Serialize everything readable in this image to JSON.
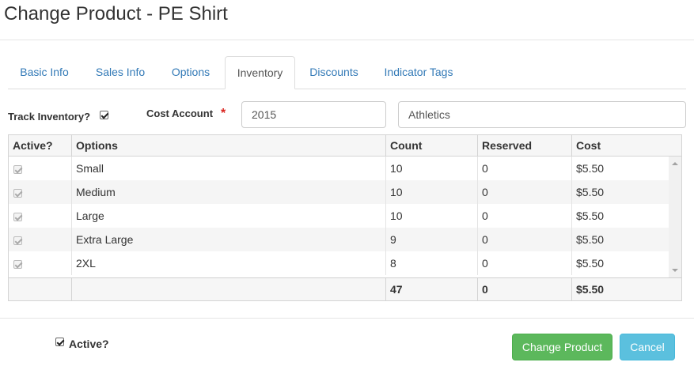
{
  "page": {
    "title": "Change Product - PE Shirt"
  },
  "tabs": [
    {
      "label": "Basic Info"
    },
    {
      "label": "Sales Info"
    },
    {
      "label": "Options"
    },
    {
      "label": "Inventory"
    },
    {
      "label": "Discounts"
    },
    {
      "label": "Indicator Tags"
    }
  ],
  "active_tab": "Inventory",
  "form": {
    "track_inventory_label": "Track Inventory?",
    "track_inventory_checked": true,
    "cost_account_label": "Cost Account",
    "required_mark": "*",
    "cost_account_code": "2015",
    "cost_account_name": "Athletics"
  },
  "grid": {
    "columns": [
      "Active?",
      "Options",
      "Count",
      "Reserved",
      "Cost"
    ],
    "rows": [
      {
        "active": true,
        "option": "Small",
        "count": "10",
        "reserved": "0",
        "cost": "$5.50"
      },
      {
        "active": true,
        "option": "Medium",
        "count": "10",
        "reserved": "0",
        "cost": "$5.50"
      },
      {
        "active": true,
        "option": "Large",
        "count": "10",
        "reserved": "0",
        "cost": "$5.50"
      },
      {
        "active": true,
        "option": "Extra Large",
        "count": "9",
        "reserved": "0",
        "cost": "$5.50"
      },
      {
        "active": true,
        "option": "2XL",
        "count": "8",
        "reserved": "0",
        "cost": "$5.50"
      }
    ],
    "totals": {
      "active": "",
      "option": "",
      "count": "47",
      "reserved": "0",
      "cost": "$5.50"
    }
  },
  "footer": {
    "active_label": "Active?",
    "active_checked": true,
    "change_button": "Change Product",
    "cancel_button": "Cancel"
  },
  "colors": {
    "link": "#337ab7",
    "success": "#5cb85c",
    "info": "#5bc0de",
    "required": "#d9231d"
  }
}
